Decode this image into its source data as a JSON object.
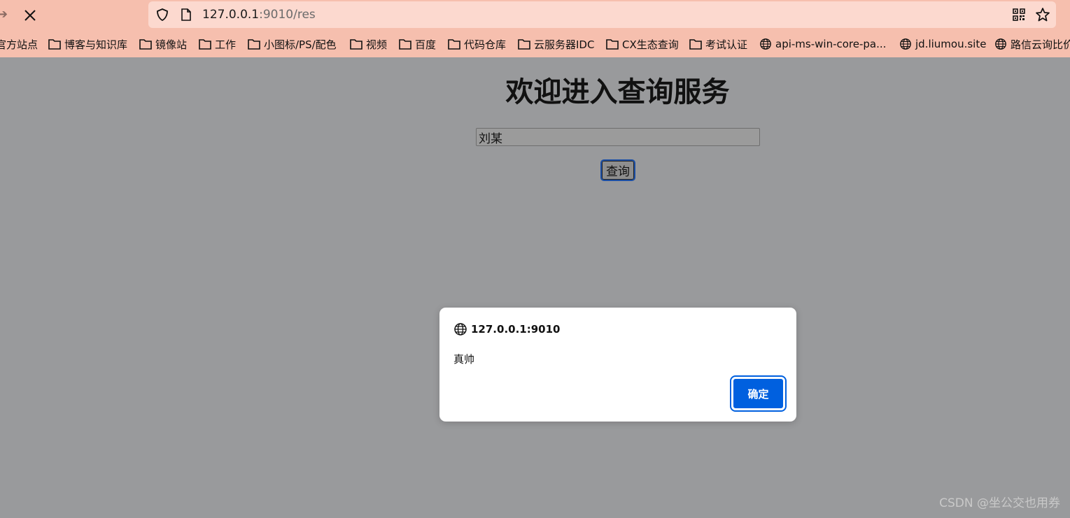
{
  "browser": {
    "url_host": "127.0.0.1",
    "url_rest": ":9010/res",
    "bookmarks": [
      {
        "label": "官方站点",
        "icon": "none"
      },
      {
        "label": "博客与知识库",
        "icon": "folder-icon"
      },
      {
        "label": "镜像站",
        "icon": "folder-icon"
      },
      {
        "label": "工作",
        "icon": "folder-icon"
      },
      {
        "label": "小图标/PS/配色",
        "icon": "folder-icon"
      },
      {
        "label": "视频",
        "icon": "folder-icon"
      },
      {
        "label": "百度",
        "icon": "folder-icon"
      },
      {
        "label": "代码仓库",
        "icon": "folder-icon"
      },
      {
        "label": "云服务器IDC",
        "icon": "folder-icon"
      },
      {
        "label": "CX生态查询",
        "icon": "folder-icon"
      },
      {
        "label": "考试认证",
        "icon": "folder-icon"
      },
      {
        "label": "api-ms-win-core-pa...",
        "icon": "globe-icon"
      },
      {
        "label": "jd.liumou.site",
        "icon": "globe-icon"
      },
      {
        "label": "路信云询比价",
        "icon": "globe-icon"
      }
    ]
  },
  "page": {
    "title": "欢迎进入查询服务",
    "input_value": "刘某",
    "button_label": "查询"
  },
  "dialog": {
    "origin": "127.0.0.1:9010",
    "message": "真帅",
    "ok_label": "确定",
    "accent_color": "#0060df"
  },
  "watermark": "CSDN @坐公交也用券"
}
